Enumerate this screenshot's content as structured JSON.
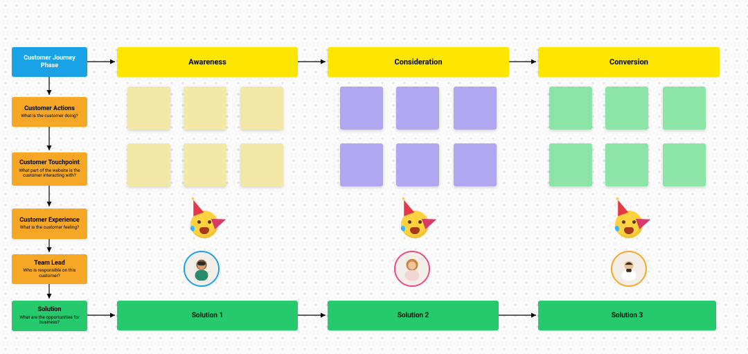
{
  "sidebar": {
    "phase": {
      "title": "Customer Journey Phase"
    },
    "actions": {
      "title": "Customer Actions",
      "sub": "What is the customer doing?"
    },
    "touchpoint": {
      "title": "Customer Touchpoint",
      "sub": "What part of the website is the customer interacting with?"
    },
    "experience": {
      "title": "Customer Experience",
      "sub": "What is the customer feeling?"
    },
    "teamlead": {
      "title": "Team Lead",
      "sub": "Who is responsible on this customer?"
    },
    "solution": {
      "title": "Solution",
      "sub": "What are the opportunities for business?"
    }
  },
  "phases": [
    {
      "name": "Awareness",
      "note_color": "yellow",
      "solution": "Solution 1",
      "avatar_ring": "#1aa2e6"
    },
    {
      "name": "Consideration",
      "note_color": "purple",
      "solution": "Solution 2",
      "avatar_ring": "#e94b86"
    },
    {
      "name": "Conversion",
      "note_color": "green",
      "solution": "Solution 3",
      "avatar_ring": "#f6a726"
    }
  ],
  "emoji": "party-face",
  "colors": {
    "header_blue": "#1aa2e6",
    "header_orange": "#f6a726",
    "header_yellow": "#ffe600",
    "solution_green": "#27c96d",
    "note_yellow": "#f2e9a8",
    "note_purple": "#b1a7f0",
    "note_green": "#8de4a7"
  }
}
